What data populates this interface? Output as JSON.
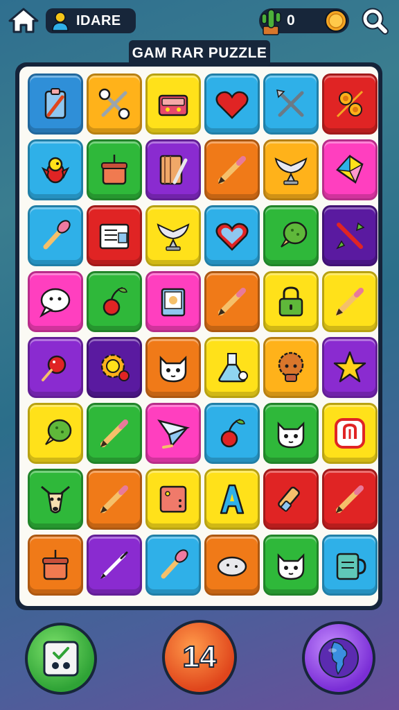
{
  "header": {
    "player_name": "IDARE",
    "coins": "0"
  },
  "title": "GAM RAR PUZZLE",
  "moves": "14",
  "board": {
    "tiles": [
      {
        "color": "#2f8fd8",
        "icon": "clipboard-pencil-icon"
      },
      {
        "color": "#ffb21a",
        "icon": "scissors-icon"
      },
      {
        "color": "#ffe11a",
        "icon": "sewing-kit-icon"
      },
      {
        "color": "#2fb0e8",
        "icon": "heart-icon"
      },
      {
        "color": "#2fb0e8",
        "icon": "crossed-tools-icon"
      },
      {
        "color": "#e02424",
        "icon": "flowers-icon"
      },
      {
        "color": "#2fb0e8",
        "icon": "parrot-icon"
      },
      {
        "color": "#2fb83a",
        "icon": "flower-pot-icon"
      },
      {
        "color": "#8a2bd0",
        "icon": "notebook-pen-icon"
      },
      {
        "color": "#f07a18",
        "icon": "pencil-icon"
      },
      {
        "color": "#ffb21a",
        "icon": "winged-trophy-icon"
      },
      {
        "color": "#ff3fbf",
        "icon": "origami-kite-icon"
      },
      {
        "color": "#2fb0e8",
        "icon": "paintbrush-icon"
      },
      {
        "color": "#e02424",
        "icon": "newspaper-icon"
      },
      {
        "color": "#ffe11a",
        "icon": "winged-trophy-icon"
      },
      {
        "color": "#2fb0e8",
        "icon": "heart-outline-icon"
      },
      {
        "color": "#2fb83a",
        "icon": "ice-cream-cone-icon"
      },
      {
        "color": "#5a1aa0",
        "icon": "arrows-stick-icon"
      },
      {
        "color": "#ff3fbf",
        "icon": "speech-bubble-icon"
      },
      {
        "color": "#2fb83a",
        "icon": "cherry-icon"
      },
      {
        "color": "#ff3fbf",
        "icon": "book-icon"
      },
      {
        "color": "#f07a18",
        "icon": "pencil-icon"
      },
      {
        "color": "#ffe11a",
        "icon": "padlock-icon"
      },
      {
        "color": "#ffe11a",
        "icon": "pencil-icon"
      },
      {
        "color": "#8a2bd0",
        "icon": "berry-icon"
      },
      {
        "color": "#5a1aa0",
        "icon": "sun-gear-icon"
      },
      {
        "color": "#f07a18",
        "icon": "cat-face-icon"
      },
      {
        "color": "#ffe11a",
        "icon": "flask-icon"
      },
      {
        "color": "#ffb21a",
        "icon": "fuzzy-creature-icon"
      },
      {
        "color": "#8a2bd0",
        "icon": "star-icon"
      },
      {
        "color": "#ffe11a",
        "icon": "ice-cream-cone-icon"
      },
      {
        "color": "#2fb83a",
        "icon": "pencil-icon"
      },
      {
        "color": "#ff3fbf",
        "icon": "paper-plane-icon"
      },
      {
        "color": "#2fb0e8",
        "icon": "cherry-icon"
      },
      {
        "color": "#2fb83a",
        "icon": "cat-face-icon"
      },
      {
        "color": "#ffe11a",
        "icon": "badge-icon"
      },
      {
        "color": "#2fb83a",
        "icon": "deer-head-icon"
      },
      {
        "color": "#f07a18",
        "icon": "pencil-icon"
      },
      {
        "color": "#ffe11a",
        "icon": "box-icon"
      },
      {
        "color": "#ffe11a",
        "icon": "letter-a-icon"
      },
      {
        "color": "#e02424",
        "icon": "highlighter-icon"
      },
      {
        "color": "#e02424",
        "icon": "pencil-icon"
      },
      {
        "color": "#f07a18",
        "icon": "flower-pot-icon"
      },
      {
        "color": "#8a2bd0",
        "icon": "pen-icon"
      },
      {
        "color": "#2fb0e8",
        "icon": "paintbrush-icon"
      },
      {
        "color": "#f07a18",
        "icon": "stone-icon"
      },
      {
        "color": "#2fb83a",
        "icon": "cat-face-icon"
      },
      {
        "color": "#2fb0e8",
        "icon": "mug-icon"
      }
    ]
  }
}
